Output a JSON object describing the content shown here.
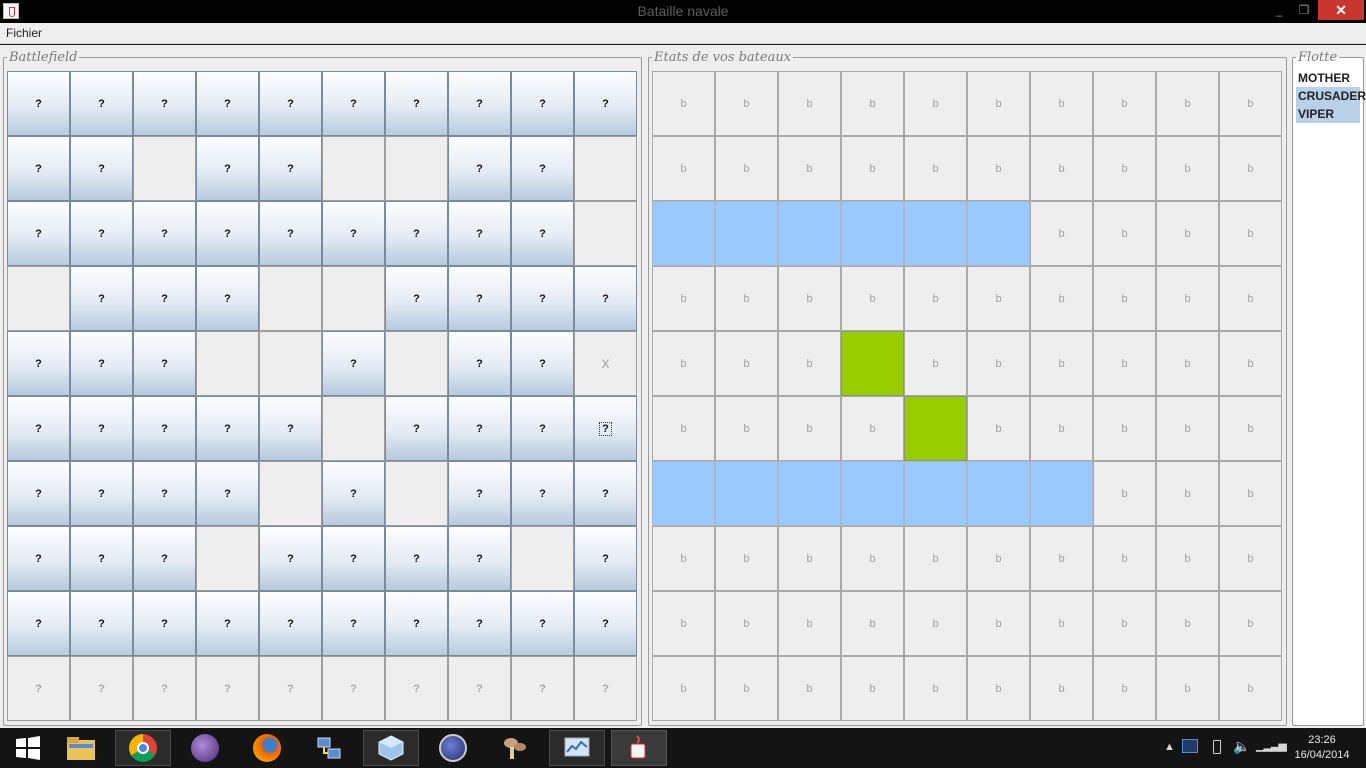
{
  "window": {
    "title": "Bataille navale",
    "controls": {
      "minimize": "_",
      "maximize": "❐",
      "close": "✕"
    }
  },
  "menu": {
    "fichier": "Fichier"
  },
  "battlefield": {
    "legend": "Battlefield",
    "rows": [
      "BBBBBBBBBB",
      "BB.BB..BB.",
      "BBBBBBBBB.",
      ".BBB..BBBB",
      "BBB..B.BBx",
      "BBBBB.BBBf",
      "BBBB.B.BBB",
      "BBB.BBBB.B",
      "BBBBBBBBBB",
      "qqqqqqqqqq"
    ],
    "button_label": "?",
    "miss_label": "X",
    "empty_label": ""
  },
  "own_board": {
    "legend": "Etats de vos bateaux",
    "label": "b",
    "rows": [
      "wwwwwwwwww",
      "wwwwwwwwww",
      "ssssssswww",
      "wwwwwwwwww",
      "wwwhwwwwww",
      "wwwwhwwwww",
      "ssssssswww",
      "wwwwwwwwww",
      "wwwwwwwwww",
      "wwwwwwwwww"
    ],
    "ship_row_lengths": {
      "2": 6,
      "6": 7
    }
  },
  "fleet": {
    "legend": "Flotte",
    "items": [
      {
        "name": "MOTHER",
        "selected": false
      },
      {
        "name": "CRUSADER",
        "selected": true
      },
      {
        "name": "VIPER",
        "selected": true
      }
    ]
  },
  "taskbar": {
    "time": "23:26",
    "date": "16/04/2014",
    "apps": [
      "start-icon",
      "file-explorer-icon",
      "chrome-icon",
      "eclipse-purple-icon",
      "firefox-icon",
      "network-icon",
      "virtualbox-icon",
      "eclipse-icon",
      "mushroom-icon",
      "task-manager-icon",
      "java-icon"
    ]
  },
  "colors": {
    "ship": "#99c9ff",
    "hit": "#99cc00",
    "close": "#c7372f"
  }
}
